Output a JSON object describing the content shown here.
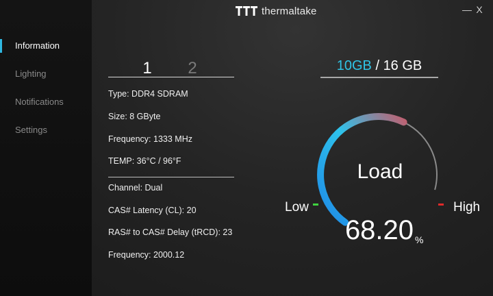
{
  "window": {
    "brand": "thermaltake",
    "minimize_label": "—",
    "close_label": "X"
  },
  "sidebar": {
    "items": [
      {
        "label": "Information",
        "active": true
      },
      {
        "label": "Lighting",
        "active": false
      },
      {
        "label": "Notifications",
        "active": false
      },
      {
        "label": "Settings",
        "active": false
      }
    ]
  },
  "modules": {
    "tabs": [
      {
        "label": "1",
        "active": true
      },
      {
        "label": "2",
        "active": false
      }
    ]
  },
  "info": {
    "type": "Type: DDR4 SDRAM",
    "size": "Size: 8 GByte",
    "frequency": "Frequency: 1333 MHz",
    "temp": "TEMP: 36°C / 96°F",
    "channel": "Channel: Dual",
    "cas": "CAS# Latency (CL): 20",
    "ras_to_cas": "RAS# to CAS# Delay (tRCD): 23",
    "frequency2": "Frequency: 2000.12"
  },
  "memory": {
    "used": "10GB",
    "separator": " / ",
    "total": "16 GB"
  },
  "gauge": {
    "title": "Load",
    "value": "68.20",
    "value_fraction": 0.682,
    "unit": "%",
    "low_label": "Low",
    "high_label": "High",
    "colors": {
      "arc_start": "#1e88e5",
      "arc_mid": "#2ec3ec",
      "arc_end": "#c06070",
      "track": "#8a8a8a",
      "low_mark": "#3fd43f",
      "high_mark": "#e12a2a",
      "accent": "#2fc4e6"
    }
  }
}
